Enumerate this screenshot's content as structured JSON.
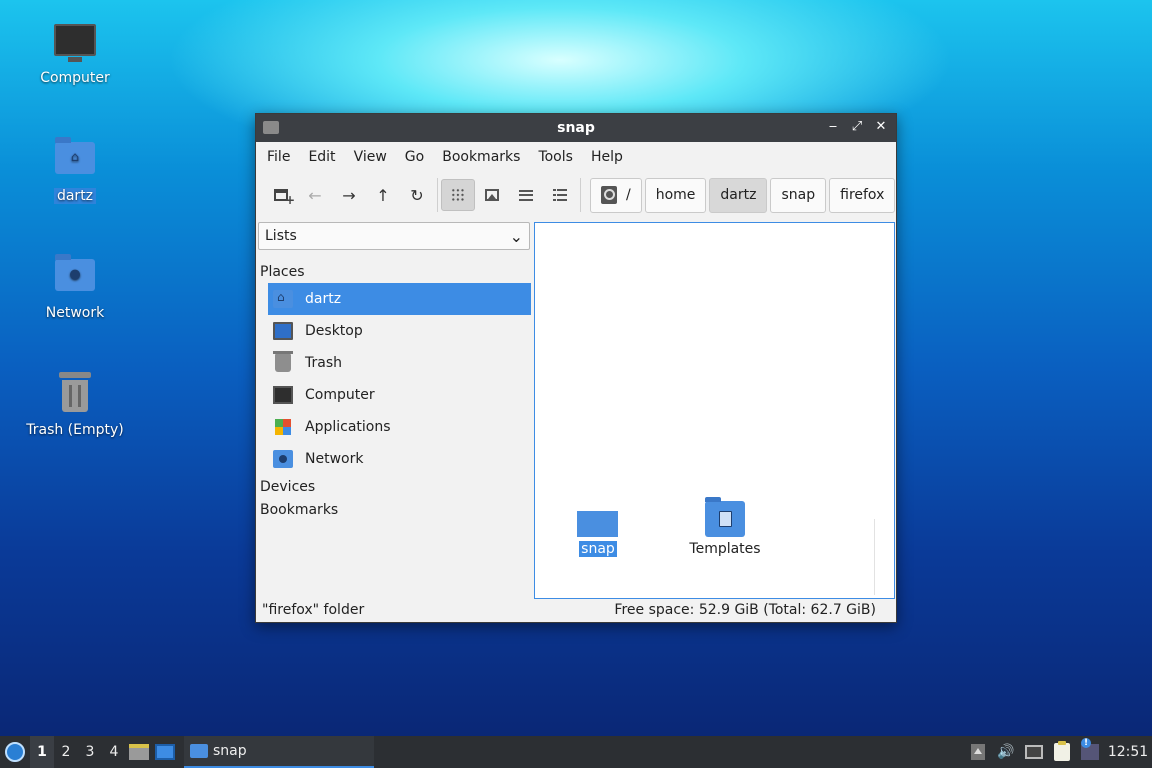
{
  "desktop": {
    "icons": [
      {
        "label": "Computer",
        "icon": "computer-icon"
      },
      {
        "label": "dartz",
        "icon": "home-folder-icon",
        "glyph": "⌂"
      },
      {
        "label": "Network",
        "icon": "network-folder-icon",
        "glyph": "●"
      },
      {
        "label": "Trash (Empty)",
        "icon": "trash-icon"
      }
    ]
  },
  "window": {
    "title": "snap",
    "controls": {
      "minimize": "‒",
      "maximize": "⤢",
      "close": "✕"
    },
    "menu": [
      "File",
      "Edit",
      "View",
      "Go",
      "Bookmarks",
      "Tools",
      "Help"
    ],
    "toolbar": {
      "back": "←",
      "forward": "→",
      "up": "↑",
      "reload": "↻"
    },
    "breadcrumbs": [
      "/",
      "home",
      "dartz",
      "snap",
      "firefox"
    ],
    "sidebar": {
      "selector": "Lists",
      "selector_arrow": "⌄",
      "places_header": "Places",
      "places": [
        {
          "label": "dartz",
          "icon": "home-icon"
        },
        {
          "label": "Desktop",
          "icon": "desktop-icon"
        },
        {
          "label": "Trash",
          "icon": "trash-icon"
        },
        {
          "label": "Computer",
          "icon": "computer-icon"
        },
        {
          "label": "Applications",
          "icon": "applications-icon"
        },
        {
          "label": "Network",
          "icon": "network-icon"
        }
      ],
      "devices_header": "Devices",
      "bookmarks_header": "Bookmarks"
    },
    "files": [
      {
        "name": "snap",
        "icon": "folder-icon",
        "selected": true
      },
      {
        "name": "Templates",
        "icon": "templates-folder-icon",
        "selected": false
      }
    ],
    "status": {
      "left": "\"firefox\" folder",
      "right": "Free space: 52.9 GiB (Total: 62.7 GiB)"
    }
  },
  "taskbar": {
    "workspaces": [
      "1",
      "2",
      "3",
      "4"
    ],
    "task_label": "snap",
    "tray": {
      "volume": "🔊"
    },
    "clock": "12:51"
  },
  "colors": {
    "accent": "#3d8ce4",
    "titlebar": "#3c3f44",
    "taskbar": "#2c2f33"
  }
}
